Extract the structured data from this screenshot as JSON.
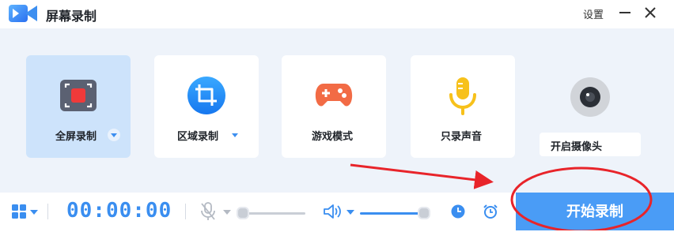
{
  "app": {
    "title": "屏幕录制",
    "settings_label": "设置"
  },
  "modes": [
    {
      "id": "fullscreen",
      "label": "全屏录制",
      "icon": "fullscreen-record-icon",
      "active": true,
      "has_dropdown": true
    },
    {
      "id": "region",
      "label": "区域录制",
      "icon": "crop-icon",
      "active": false,
      "has_dropdown": true
    },
    {
      "id": "game",
      "label": "游戏模式",
      "icon": "gamepad-icon",
      "active": false,
      "has_dropdown": false
    },
    {
      "id": "audio",
      "label": "只录声音",
      "icon": "microphone-icon",
      "active": false,
      "has_dropdown": false
    }
  ],
  "camera": {
    "label": "开启摄像头",
    "icon": "webcam-icon"
  },
  "toolbar": {
    "timer": "00:00:00",
    "layout_icon": "grid-icon",
    "mic_icon": "microphone-muted-icon",
    "speaker_icon": "speaker-icon",
    "mic_level": 0.0,
    "volume_level": 1.0,
    "schedule_icon": "clock-icon",
    "alarm_icon": "alarm-clock-icon"
  },
  "start_button": {
    "label": "开始录制"
  },
  "colors": {
    "accent": "#3a8ef0",
    "start_button": "#4a9cf6",
    "annotation": "#e8242a",
    "active_card": "#cde3fb"
  }
}
